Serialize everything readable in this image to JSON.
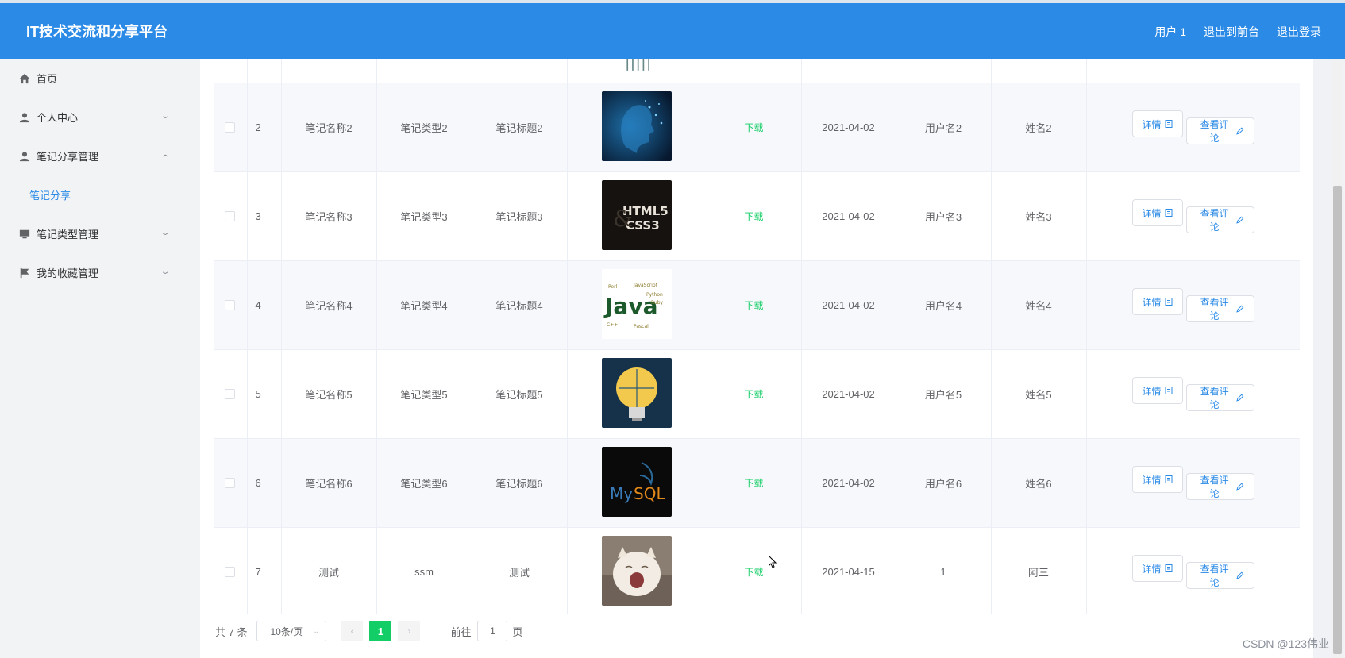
{
  "header": {
    "title": "IT技术交流和分享平台",
    "links": [
      "用户 1",
      "退出到前台",
      "退出登录"
    ],
    "bg_color": "#2a8ae6"
  },
  "sidebar": {
    "items": [
      {
        "label": "首页",
        "icon": "home-icon",
        "arrow": ""
      },
      {
        "label": "个人中心",
        "icon": "user-icon",
        "arrow": "chevron-down-icon"
      },
      {
        "label": "笔记分享管理",
        "icon": "user-icon",
        "arrow": "chevron-up-icon"
      },
      {
        "label": "笔记分享",
        "sub": true
      },
      {
        "label": "笔记类型管理",
        "icon": "monitor-icon",
        "arrow": "chevron-down-icon"
      },
      {
        "label": "我的收藏管理",
        "icon": "flag-icon",
        "arrow": "chevron-down-icon"
      }
    ],
    "active_color": "#2a8ae6"
  },
  "table": {
    "download_label": "下载",
    "detail_label": "详情",
    "review_label": "查看评论",
    "rows": [
      {
        "index": "",
        "name": "",
        "type": "",
        "title": "",
        "date": "",
        "username": "",
        "realname": "",
        "partial": true,
        "image": "ai-figure"
      },
      {
        "index": "2",
        "name": "笔记名称2",
        "type": "笔记类型2",
        "title": "笔记标题2",
        "date": "2021-04-02",
        "username": "用户名2",
        "realname": "姓名2",
        "image": "ai-head"
      },
      {
        "index": "3",
        "name": "笔记名称3",
        "type": "笔记类型3",
        "title": "笔记标题3",
        "date": "2021-04-02",
        "username": "用户名3",
        "realname": "姓名3",
        "image": "html5-css3"
      },
      {
        "index": "4",
        "name": "笔记名称4",
        "type": "笔记类型4",
        "title": "笔记标题4",
        "date": "2021-04-02",
        "username": "用户名4",
        "realname": "姓名4",
        "image": "java-wordcloud"
      },
      {
        "index": "5",
        "name": "笔记名称5",
        "type": "笔记类型5",
        "title": "笔记标题5",
        "date": "2021-04-02",
        "username": "用户名5",
        "realname": "姓名5",
        "image": "lightbulb"
      },
      {
        "index": "6",
        "name": "笔记名称6",
        "type": "笔记类型6",
        "title": "笔记标题6",
        "date": "2021-04-02",
        "username": "用户名6",
        "realname": "姓名6",
        "image": "mysql-logo"
      },
      {
        "index": "7",
        "name": "测试",
        "type": "ssm",
        "title": "测试",
        "date": "2021-04-15",
        "username": "1",
        "realname": "阿三",
        "image": "cat-photo"
      }
    ],
    "download_color": "#13ce66",
    "button_color": "#2a8ae6"
  },
  "pagination": {
    "total_text": "共 7 条",
    "page_size": "10条/页",
    "current_page": "1",
    "goto_label": "前往",
    "goto_value": "1",
    "page_suffix": "页",
    "active_color": "#13ce66"
  },
  "watermark": "CSDN @123伟业"
}
